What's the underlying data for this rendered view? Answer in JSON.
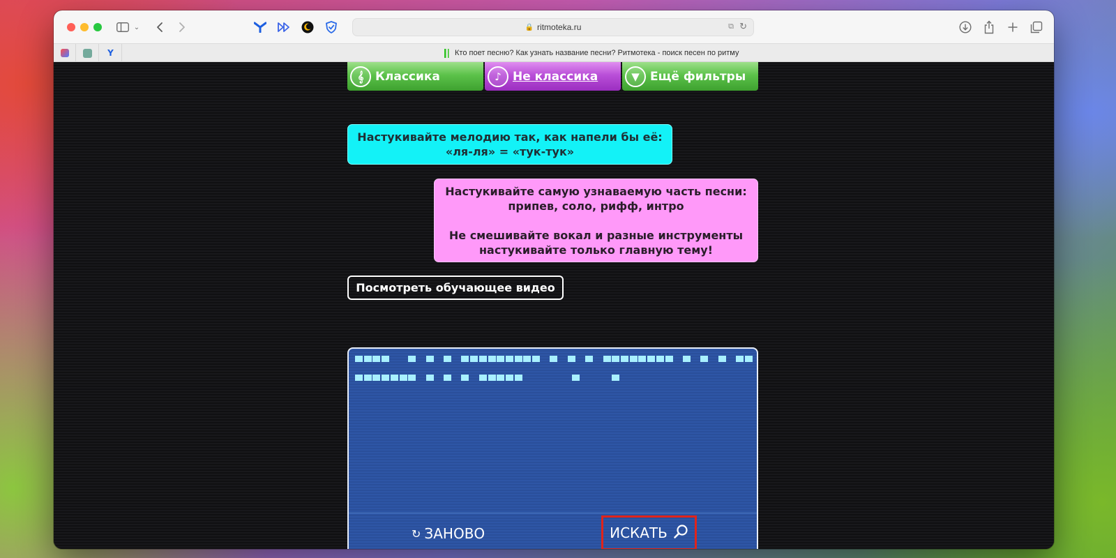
{
  "browser": {
    "url": "ritmoteka.ru",
    "tab_title": "Кто поет песню? Как узнать название песни? Ритмотека - поиск песен по ритму"
  },
  "filters": [
    {
      "label": "Классика",
      "icon": "violin-icon",
      "glyph": "🎻",
      "color": "#5cc24a"
    },
    {
      "label": "Не классика",
      "icon": "guitar-icon",
      "glyph": "♪",
      "color": "#b94fd8"
    },
    {
      "label": "Ещё фильтры",
      "icon": "funnel-icon",
      "glyph": "▼",
      "color": "#5cc24a"
    }
  ],
  "tips": {
    "melody_line1": "Настукивайте мелодию так, как напели бы её:",
    "melody_line2": "«ля-ля» = «тук-тук»",
    "part_line1": "Настукивайте самую узнаваемую часть песни:",
    "part_line2": "припев, соло, рифф, интро",
    "mix_line1": "Не смешивайте вокал и разные инструменты",
    "mix_line2": "настукивайте только главную тему!"
  },
  "video_button": "Посмотреть обучающее видео",
  "tap_area": {
    "rhythm_row1": [
      0,
      1,
      2,
      3,
      6,
      8,
      10,
      12,
      13,
      14,
      15,
      16,
      17,
      18,
      19,
      20,
      22,
      24,
      26,
      28,
      29,
      30,
      31,
      32,
      33,
      34,
      35,
      37,
      39,
      41,
      43,
      44
    ],
    "rhythm_row2": [
      0,
      1,
      2,
      3,
      4,
      5,
      6,
      8,
      10,
      12,
      14,
      15,
      16,
      17,
      18,
      24.5,
      29
    ],
    "reset_label": "ЗАНОВО",
    "search_label": "ИСКАТЬ"
  },
  "colors": {
    "tip_cyan": "#13f2f7",
    "tip_pink": "#ff99f9",
    "beat": "#a8f0ff",
    "search_highlight": "#e0241b"
  }
}
